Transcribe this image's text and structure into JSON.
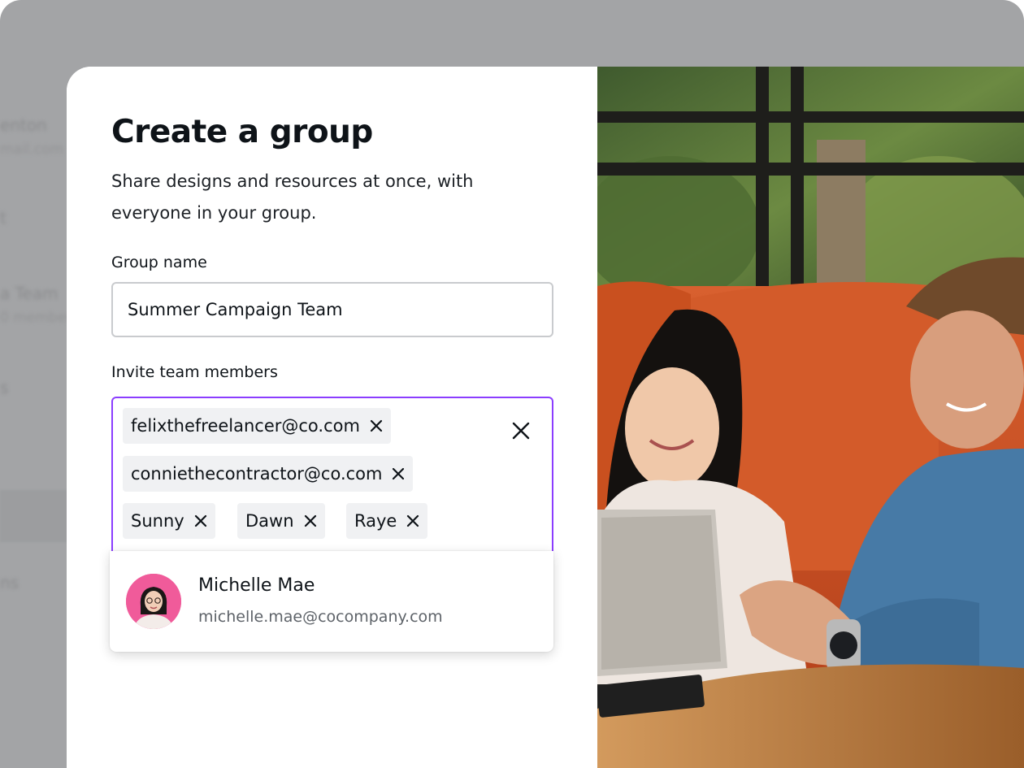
{
  "background_list": {
    "items": [
      {
        "title": "enton",
        "subtitle": "mail.com"
      },
      {
        "title": "t",
        "subtitle": ""
      },
      {
        "title": "a Team",
        "subtitle": "0 member"
      },
      {
        "title": "s",
        "subtitle": ""
      },
      {
        "title": "ns",
        "subtitle": ""
      }
    ]
  },
  "dialog": {
    "title": "Create a group",
    "description": "Share designs and resources at once, with everyone in your group.",
    "group_name": {
      "label": "Group name",
      "value": "Summer Campaign Team"
    },
    "invite": {
      "label": "Invite team members",
      "chips": [
        {
          "text": "felixthefreelancer@co.com"
        },
        {
          "text": "conniethecontractor@co.com"
        },
        {
          "text": "Sunny"
        },
        {
          "text": "Dawn"
        },
        {
          "text": "Raye"
        }
      ],
      "clear_icon": "close-icon"
    },
    "suggestion": {
      "name": "Michelle Mae",
      "email": "michelle.mae@cocompany.com"
    }
  },
  "colors": {
    "accent": "#8b3dff",
    "text": "#0e1318",
    "chip_bg": "#f0f1f3",
    "avatar_bg": "#f05b9a",
    "sofa": "#d95a2b"
  },
  "icons": {
    "remove_chip": "close-icon",
    "clear_all": "close-icon"
  }
}
